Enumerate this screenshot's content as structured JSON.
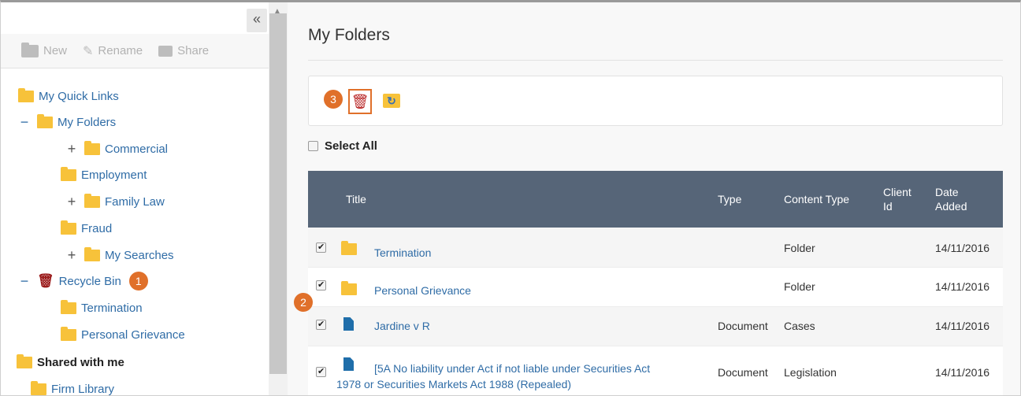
{
  "sidebar": {
    "collapse_label": "«",
    "toolbar": {
      "new_label": "New",
      "rename_label": "Rename",
      "share_label": "Share"
    },
    "tree": {
      "quick_links": "My Quick Links",
      "my_folders": "My Folders",
      "commercial": "Commercial",
      "employment": "Employment",
      "family_law": "Family Law",
      "fraud": "Fraud",
      "my_searches": "My Searches",
      "recycle_bin": "Recycle Bin",
      "recycle_badge": "1",
      "termination": "Termination",
      "personal_grievance": "Personal Grievance",
      "shared_with_me": "Shared with me",
      "firm_library": "Firm Library"
    },
    "toggles": {
      "minus": "−",
      "plus": "+"
    }
  },
  "main": {
    "title": "My Folders",
    "action_badge": "3",
    "select_all": "Select All",
    "row_badge": "2",
    "columns": {
      "title": "Title",
      "type": "Type",
      "content_type": "Content Type",
      "client_id": "Client Id",
      "date_added": "Date Added"
    },
    "rows": [
      {
        "title": "Termination",
        "type": "",
        "content_type": "Folder",
        "date": "14/11/2016",
        "icon": "folder"
      },
      {
        "title": "Personal Grievance",
        "type": "",
        "content_type": "Folder",
        "date": "14/11/2016",
        "icon": "folder"
      },
      {
        "title": "Jardine v R",
        "type": "Document",
        "content_type": "Cases",
        "date": "14/11/2016",
        "icon": "document"
      },
      {
        "title_line1": "[5A No liability under Act if not liable under Securities Act",
        "title_line2": "1978 or Securities Markets Act 1988 (Repealed)",
        "type": "Document",
        "content_type": "Legislation",
        "date": "14/11/2016",
        "icon": "document"
      }
    ]
  },
  "colors": {
    "header": "#566578",
    "link": "#2f6ca6",
    "accent": "#e0702a",
    "folder": "#f7c23a",
    "bin": "#9b1c1c"
  }
}
